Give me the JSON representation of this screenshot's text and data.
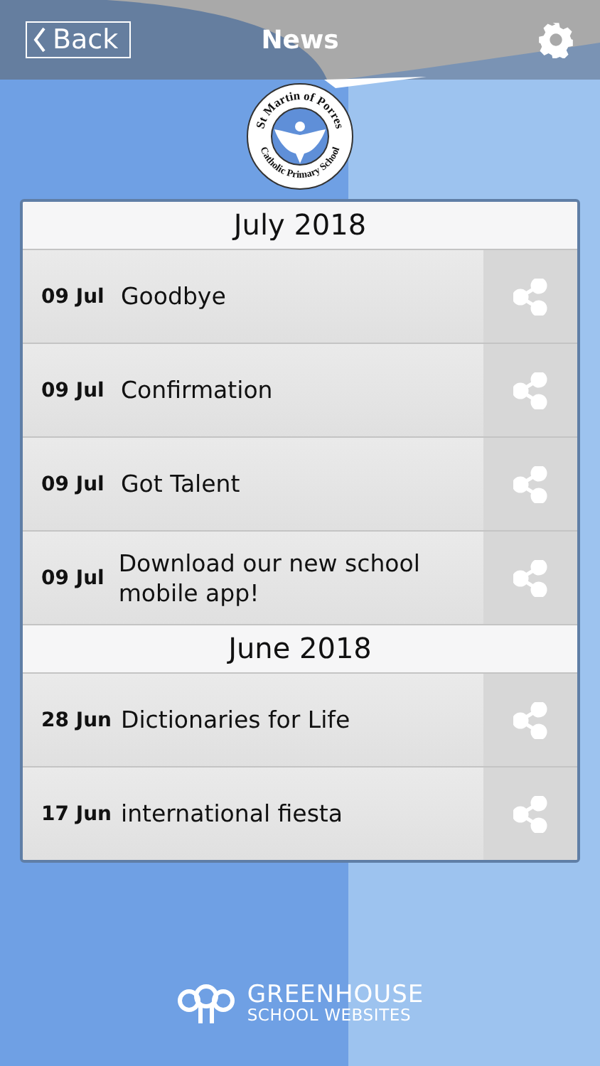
{
  "header": {
    "back": "Back",
    "title": "News"
  },
  "school_logo": {
    "top_text": "St Martin of Porres",
    "bottom_text": "Catholic Primary School"
  },
  "sections": [
    {
      "month": "July 2018",
      "items": [
        {
          "date": "09 Jul",
          "title": "Goodbye"
        },
        {
          "date": "09 Jul",
          "title": "Confirmation"
        },
        {
          "date": "09 Jul",
          "title": "Got Talent"
        },
        {
          "date": "09 Jul",
          "title": "Download our new school mobile app!"
        }
      ]
    },
    {
      "month": "June 2018",
      "items": [
        {
          "date": "28 Jun",
          "title": "Dictionaries for Life"
        },
        {
          "date": "17 Jun",
          "title": "international fiesta"
        }
      ]
    }
  ],
  "footer": {
    "brand": "GREENHOUSE",
    "tagline": "SCHOOL WEBSITES"
  }
}
